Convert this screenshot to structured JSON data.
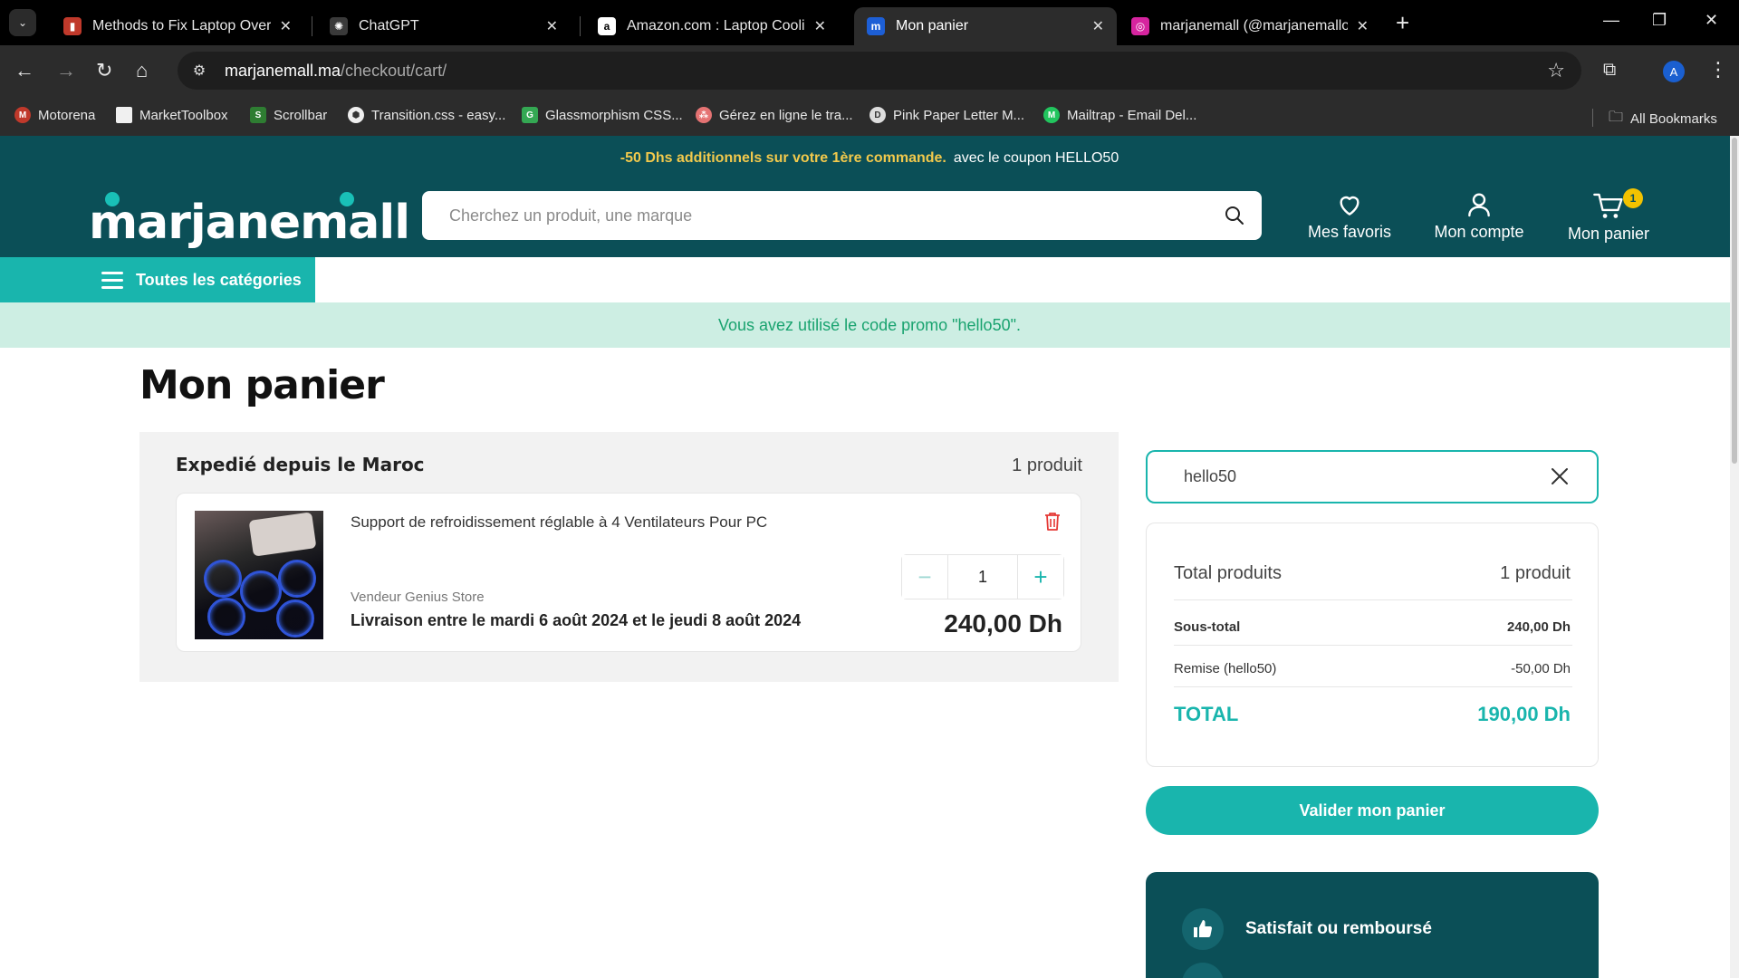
{
  "browser": {
    "tabs": [
      {
        "title": "Methods to Fix Laptop Overheating",
        "favicon_color": "#c0392b",
        "favicon_glyph": "▮",
        "active": false
      },
      {
        "title": "ChatGPT",
        "favicon_color": "#3a3a3a",
        "favicon_glyph": "✺",
        "active": false
      },
      {
        "title": "Amazon.com : Laptop Cooling Pad",
        "favicon_color": "#ffffff",
        "favicon_glyph": "a",
        "active": false
      },
      {
        "title": "Mon panier",
        "favicon_color": "#1d5fd6",
        "favicon_glyph": "m",
        "active": true
      },
      {
        "title": "marjanemall (@marjanemallofficiel)",
        "favicon_color": "#d6249f",
        "favicon_glyph": "◎",
        "active": false
      }
    ],
    "url_host": "marjanemall.ma",
    "url_path": "/checkout/cart/",
    "profile_initial": "A",
    "bookmarks": [
      {
        "label": "Motorena",
        "color": "#c0392b"
      },
      {
        "label": "MarketToolbox",
        "color": "#f0f0f0"
      },
      {
        "label": "Scrollbar",
        "color": "#2e7d32"
      },
      {
        "label": "Transition.css - easy...",
        "color": "#eeeeee"
      },
      {
        "label": "Glassmorphism CSS...",
        "color": "#34a853"
      },
      {
        "label": "Gérez en ligne le tra...",
        "color": "#e57373"
      },
      {
        "label": "Pink Paper Letter M...",
        "color": "#dddddd"
      },
      {
        "label": "Mailtrap - Email Del...",
        "color": "#22c55e"
      }
    ],
    "all_bookmarks_label": "All Bookmarks"
  },
  "site": {
    "promo_highlight": "-50 Dhs additionnels sur votre 1ère commande.",
    "promo_rest": "avec le coupon HELLO50",
    "logo_text": "marjanemall",
    "search_placeholder": "Cherchez un produit, une marque",
    "favorites_label": "Mes favoris",
    "account_label": "Mon compte",
    "cart_label": "Mon panier",
    "cart_count": "1",
    "categories_label": "Toutes les catégories",
    "promo_notice": "Vous avez utilisé le code promo \"hello50\".",
    "brand_color": "#0b4f57",
    "accent_color": "#19b5ad"
  },
  "cart": {
    "title": "Mon panier",
    "shipping_group": "Expedié depuis le Maroc",
    "shipping_count": "1 produit",
    "item": {
      "name": "Support de refroidissement réglable à 4 Ventilateurs Pour PC",
      "vendor": "Vendeur Genius Store",
      "delivery": "Livraison entre le mardi 6 août 2024 et le jeudi 8 août 2024",
      "quantity": "1",
      "price": "240,00 Dh"
    }
  },
  "summary": {
    "coupon_value": "hello50",
    "total_products_label": "Total produits",
    "total_products_value": "1 produit",
    "subtotal_label": "Sous-total",
    "subtotal_value": "240,00 Dh",
    "discount_label": "Remise (hello50)",
    "discount_value": "-50,00 Dh",
    "total_label": "TOTAL",
    "total_value": "190,00 Dh",
    "validate_label": "Valider mon panier",
    "guarantee_1": "Satisfait ou remboursé"
  }
}
